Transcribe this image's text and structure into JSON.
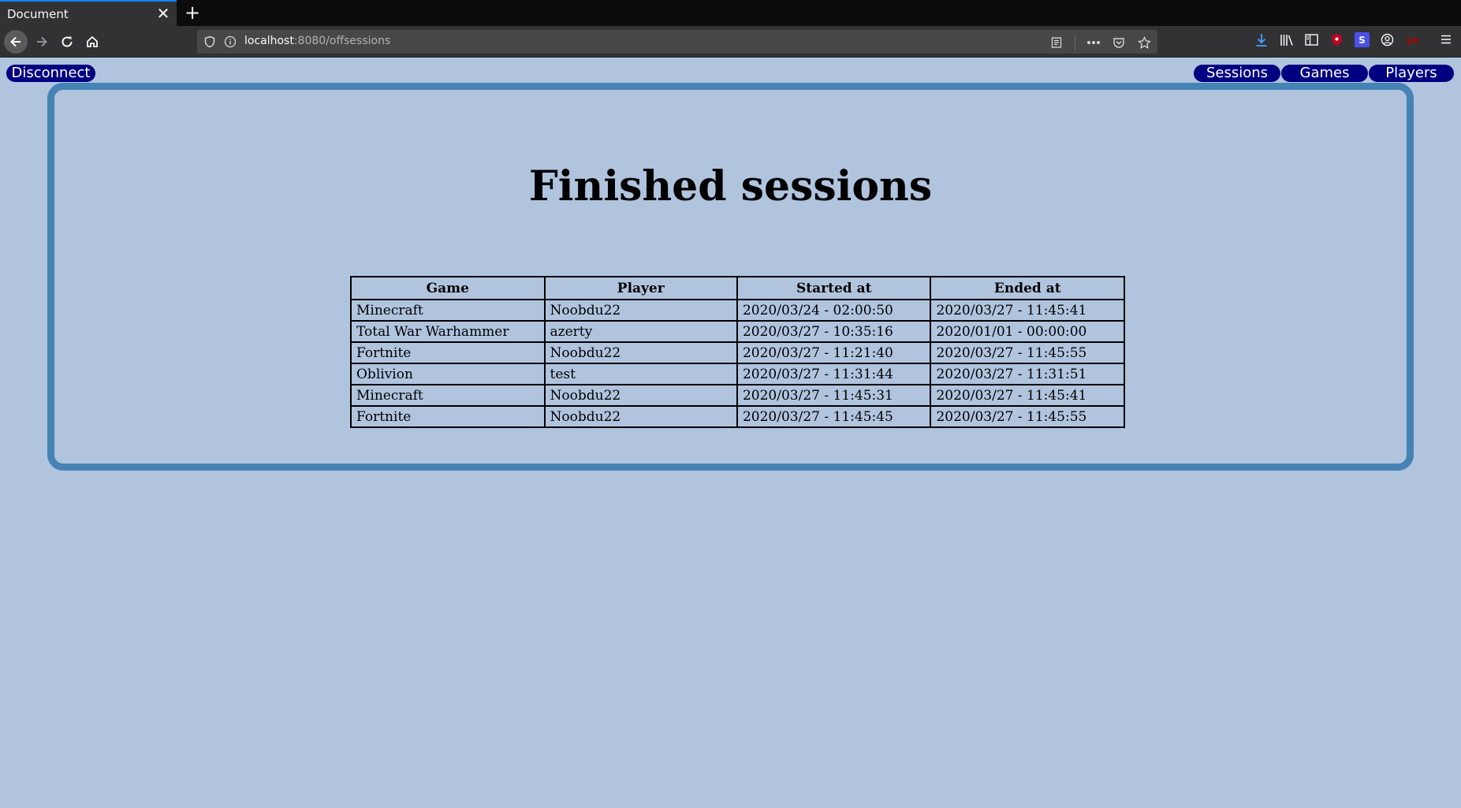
{
  "browser": {
    "tab_title": "Document",
    "tab_close": "✕",
    "new_tab": "+",
    "url_host": "localhost",
    "url_path": ":8080/offsessions",
    "toolbar_icons": [
      "download-icon",
      "library-icon",
      "sidebar-icon",
      "ublock-icon",
      "extension-s-icon",
      "account-icon",
      "extension-yo-icon",
      "menu-icon"
    ]
  },
  "header": {
    "disconnect_label": "Disconnect",
    "nav": {
      "sessions": "Sessions",
      "games": "Games",
      "players": "Players"
    }
  },
  "main": {
    "title": "Finished sessions",
    "table": {
      "headers": [
        "Game",
        "Player",
        "Started at",
        "Ended at"
      ],
      "rows": [
        [
          "Minecraft",
          "Noobdu22",
          "2020/03/24 - 02:00:50",
          "2020/03/27 - 11:45:41"
        ],
        [
          "Total War Warhammer",
          "azerty",
          "2020/03/27 - 10:35:16",
          "2020/01/01 - 00:00:00"
        ],
        [
          "Fortnite",
          "Noobdu22",
          "2020/03/27 - 11:21:40",
          "2020/03/27 - 11:45:55"
        ],
        [
          "Oblivion",
          "test",
          "2020/03/27 - 11:31:44",
          "2020/03/27 - 11:31:51"
        ],
        [
          "Minecraft",
          "Noobdu22",
          "2020/03/27 - 11:45:31",
          "2020/03/27 - 11:45:41"
        ],
        [
          "Fortnite",
          "Noobdu22",
          "2020/03/27 - 11:45:45",
          "2020/03/27 - 11:45:55"
        ]
      ]
    }
  },
  "colors": {
    "page_background": "#b0c4de",
    "frame_border": "#4682b4",
    "pill_background": "#000080"
  }
}
